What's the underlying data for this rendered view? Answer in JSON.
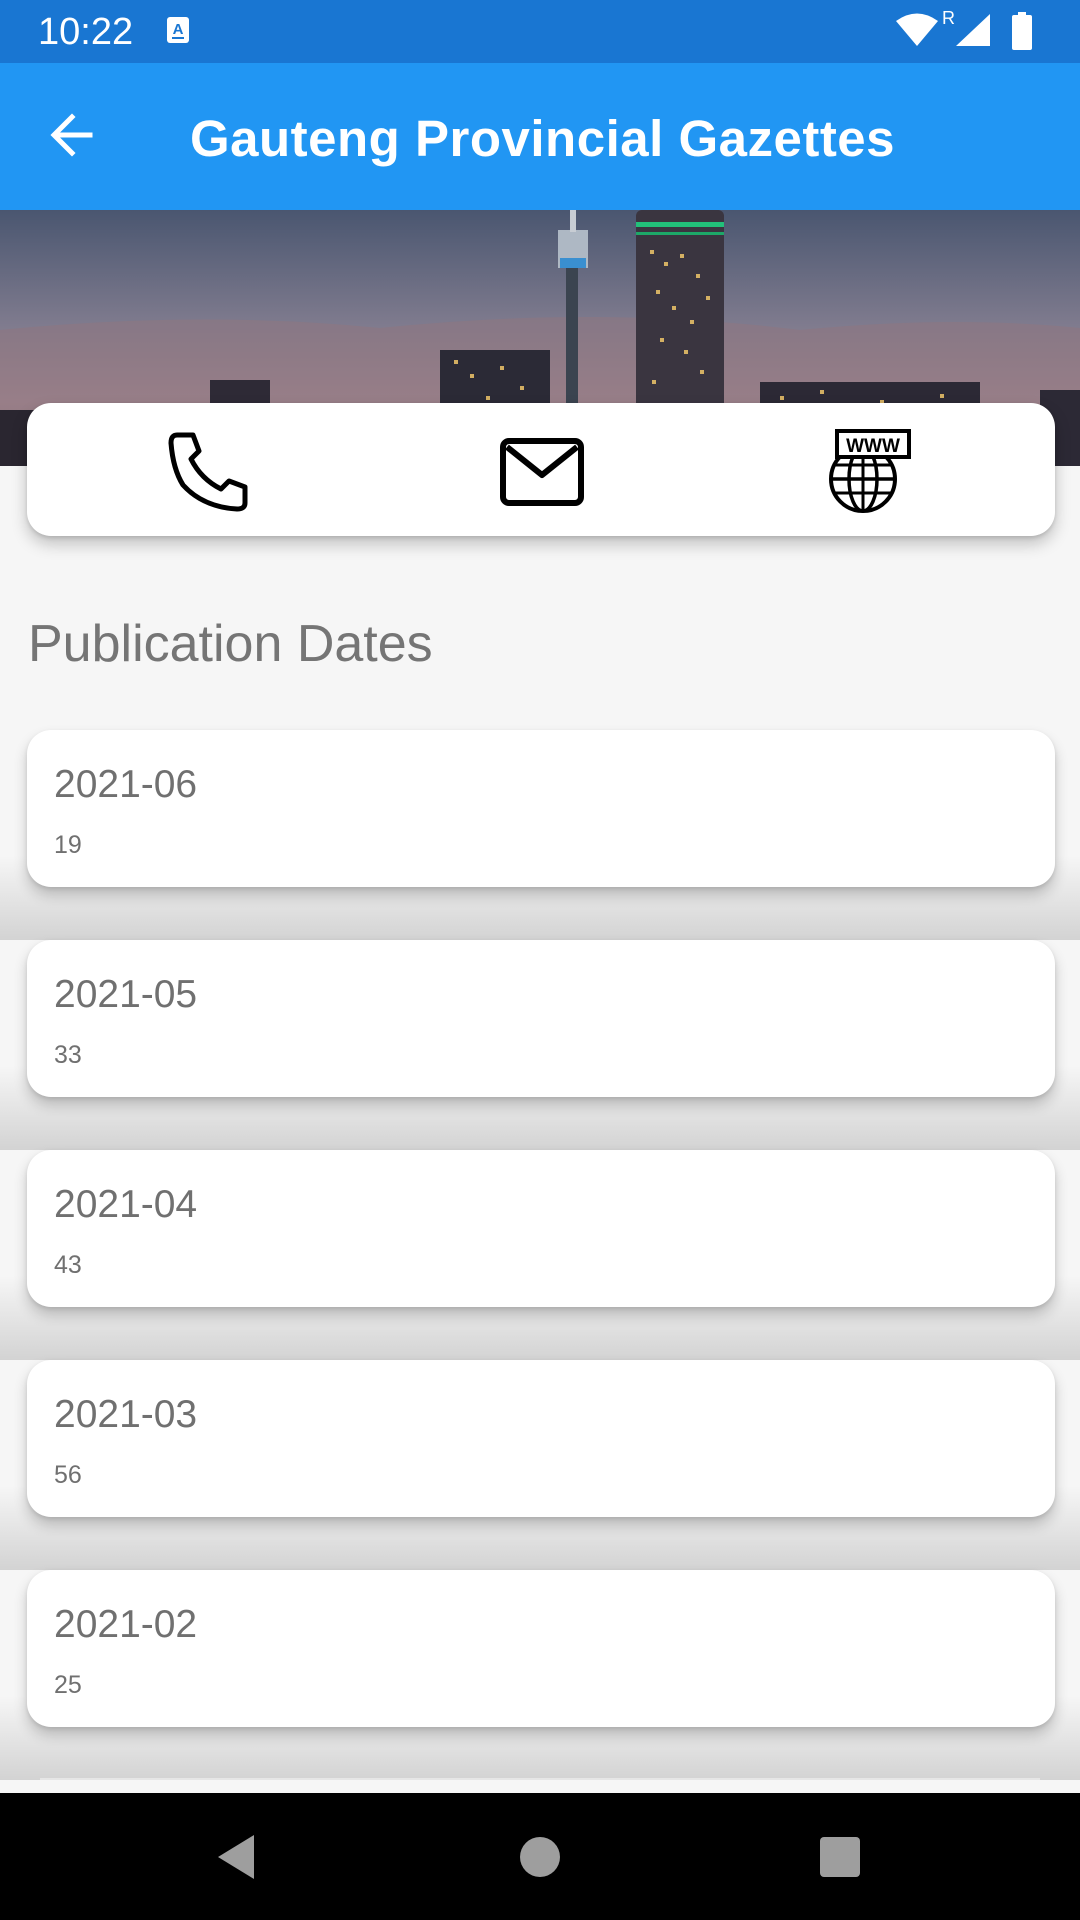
{
  "status_bar": {
    "time": "10:22",
    "network_indicator": "R"
  },
  "app_bar": {
    "back_icon": "arrow-left-icon",
    "title": "Gauteng Provincial Gazettes",
    "color": "#2196f3"
  },
  "contact": {
    "items": [
      {
        "icon": "phone-icon"
      },
      {
        "icon": "mail-icon"
      },
      {
        "icon": "globe-www-icon",
        "label": "WWW"
      }
    ]
  },
  "section": {
    "title": "Publication Dates"
  },
  "dates": [
    {
      "label": "2021-06",
      "count": "19"
    },
    {
      "label": "2021-05",
      "count": "33"
    },
    {
      "label": "2021-04",
      "count": "43"
    },
    {
      "label": "2021-03",
      "count": "56"
    },
    {
      "label": "2021-02",
      "count": "25"
    }
  ],
  "nav_bar": {
    "back": "triangle-back-icon",
    "home": "circle-home-icon",
    "recents": "square-recents-icon"
  }
}
